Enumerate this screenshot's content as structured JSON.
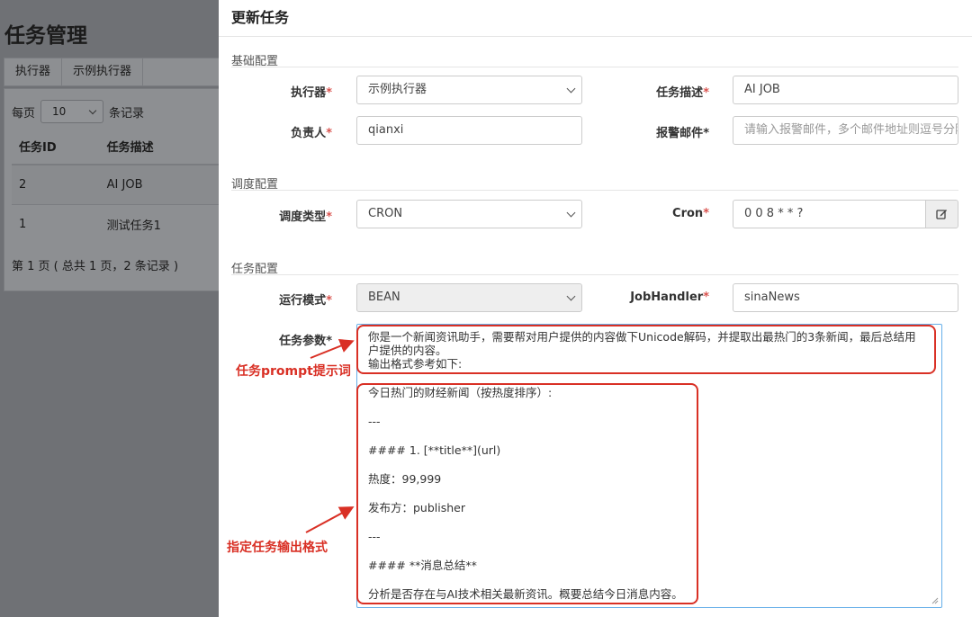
{
  "bg": {
    "title": "任务管理",
    "tabs": [
      "执行器",
      "示例执行器"
    ],
    "per_page_prefix": "每页",
    "per_page_value": "10",
    "per_page_suffix": "条记录",
    "columns": [
      "任务ID",
      "任务描述"
    ],
    "rows": [
      {
        "id": "2",
        "desc": "AI JOB"
      },
      {
        "id": "1",
        "desc": "测试任务1"
      }
    ],
    "page_info": "第 1 页 ( 总共 1 页，2 条记录 )"
  },
  "modal": {
    "title": "更新任务",
    "sections": {
      "basic": "基础配置",
      "schedule": "调度配置",
      "task": "任务配置"
    },
    "fields": {
      "executor": {
        "label": "执行器",
        "value": "示例执行器"
      },
      "desc": {
        "label": "任务描述",
        "value": "AI JOB"
      },
      "owner": {
        "label": "负责人",
        "value": "qianxi"
      },
      "email": {
        "label": "报警邮件",
        "placeholder": "请输入报警邮件，多个邮件地址则逗号分隔"
      },
      "sched_type": {
        "label": "调度类型",
        "value": "CRON"
      },
      "cron": {
        "label": "Cron",
        "value": "0 0 8 * * ?"
      },
      "run_mode": {
        "label": "运行模式",
        "value": "BEAN"
      },
      "handler": {
        "label": "JobHandler",
        "value": "sinaNews"
      },
      "params": {
        "label": "任务参数"
      }
    },
    "required_mark": "*",
    "params_text": {
      "line1": "你是一个新闻资讯助手，需要帮对用户提供的内容做下Unicode解码，并提取出最热门的3条新闻，最后总结用",
      "line2": "户提供的内容。",
      "line3": "输出格式参考如下:",
      "l4": "今日热门的财经新闻（按热度排序）:",
      "l5": "---",
      "l6": "#### 1. [**title**](url)",
      "l7": "热度：99,999",
      "l8": "发布方：publisher",
      "l9": "---",
      "l10": "#### **消息总结**",
      "l11": "分析是否存在与AI技术相关最新资讯。概要总结今日消息内容。"
    }
  },
  "annotations": {
    "prompt": "任务prompt提示词",
    "format": "指定任务输出格式"
  },
  "colors": {
    "annotation": "#d93025",
    "required": "#d9534f",
    "focus_border": "#66afe9"
  },
  "icons": {
    "cron_edit": "edit-icon"
  }
}
